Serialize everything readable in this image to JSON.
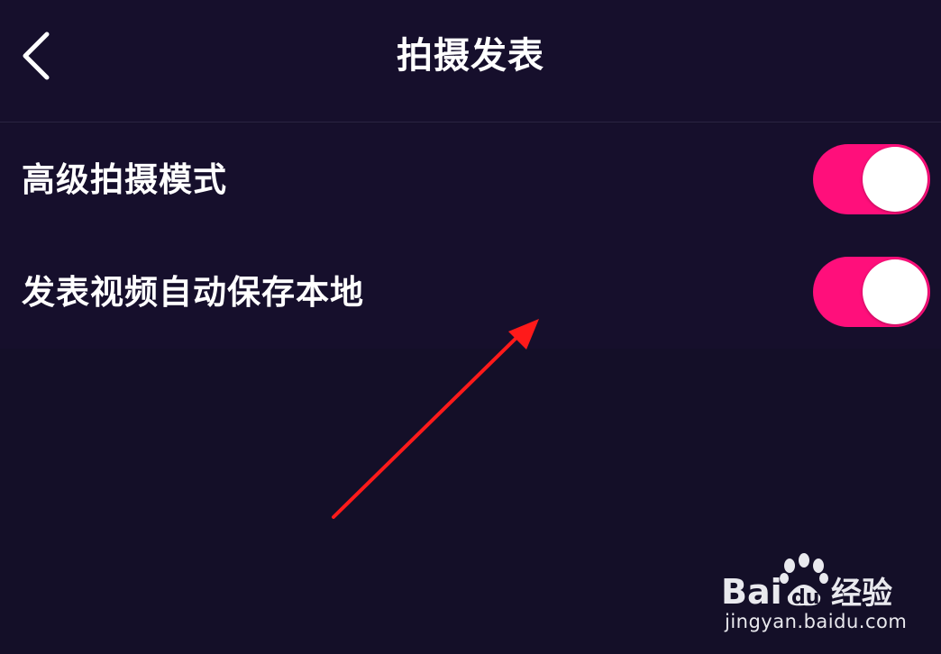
{
  "header": {
    "title": "拍摄发表",
    "back_icon": "chevron-left-icon"
  },
  "settings": [
    {
      "label": "高级拍摄模式",
      "enabled": true
    },
    {
      "label": "发表视频自动保存本地",
      "enabled": true
    }
  ],
  "colors": {
    "background": "#140f28",
    "toggle_on": "#ff0f7b",
    "annotation": "#ff1a1a"
  },
  "watermark": {
    "brand": "Baidu经验",
    "url": "jingyan.baidu.com"
  }
}
